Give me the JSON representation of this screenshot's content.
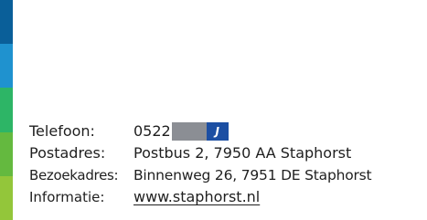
{
  "palette": {
    "bar_colors": [
      "#0a5f99",
      "#1f92cf",
      "#2db566",
      "#64b93f",
      "#93c63a"
    ]
  },
  "contact": {
    "phone": {
      "label": "Telefoon:",
      "prefix": "0522",
      "badge": "J"
    },
    "postal": {
      "label": "Postadres:",
      "value": "Postbus 2, 7950 AA Staphorst"
    },
    "visit": {
      "label": "Bezoekadres:",
      "value": "Binnenweg 26, 7951 DE Staphorst"
    },
    "info": {
      "label": "Informatie:",
      "value": "www.staphorst.nl"
    }
  }
}
